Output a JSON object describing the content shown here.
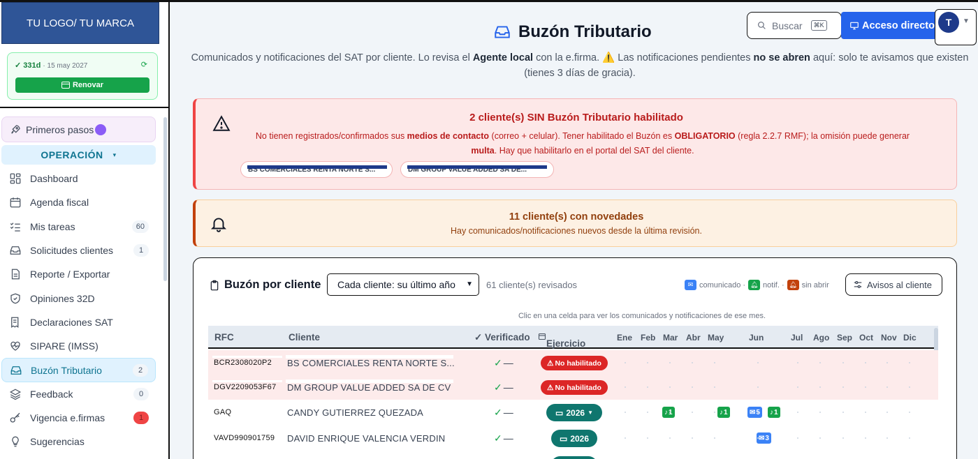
{
  "brand": {
    "logo_text": "TU LOGO/ TU MARCA"
  },
  "license": {
    "days": "✓ 331d",
    "date": "· 15 may 2027",
    "renew_label": "Renovar"
  },
  "sidebar": {
    "first_steps": "Primeros pasos",
    "section": "OPERACIÓN",
    "items": [
      {
        "label": "Dashboard",
        "icon": "dashboard-icon",
        "badge": ""
      },
      {
        "label": "Agenda fiscal",
        "icon": "calendar-icon",
        "badge": ""
      },
      {
        "label": "Mis tareas",
        "icon": "tasks-icon",
        "badge": "60"
      },
      {
        "label": "Solicitudes clientes",
        "icon": "inbox-icon",
        "badge": "1"
      },
      {
        "label": "Reporte / Exportar",
        "icon": "document-icon",
        "badge": ""
      },
      {
        "label": "Opiniones 32D",
        "icon": "shield-icon",
        "badge": ""
      },
      {
        "label": "Declaraciones SAT",
        "icon": "receipt-icon",
        "badge": ""
      },
      {
        "label": "SIPARE (IMSS)",
        "icon": "heart-pulse-icon",
        "badge": ""
      },
      {
        "label": "Buzón Tributario",
        "icon": "inbox-icon",
        "badge": "2"
      },
      {
        "label": "Feedback",
        "icon": "layers-icon",
        "badge": "0"
      },
      {
        "label": "Vigencia e.firmas",
        "icon": "key-icon",
        "badge": "1"
      },
      {
        "label": "Sugerencias",
        "icon": "lightbulb-icon",
        "badge": ""
      }
    ]
  },
  "header": {
    "title": "Buzón Tributario",
    "subtitle_1": "Comunicados y notificaciones del SAT por cliente. Lo revisa el ",
    "subtitle_b1": "Agente local",
    "subtitle_2": " con la e.firma. ⚠️ Las notificaciones pendientes ",
    "subtitle_b2": "no se abren",
    "subtitle_3": " aquí: solo te avisamos que existen (tienes 3 días de gracia).",
    "search_placeholder": "Buscar",
    "search_shortcut": "⌘K",
    "direct_label": "Acceso directo",
    "avatar_initial": "T"
  },
  "alert_red": {
    "title": "2 cliente(s) SIN Buzón Tributario habilitado",
    "t1": "No tienen registrados/confirmados sus ",
    "b1": "medios de contacto",
    "t2": " (correo + celular). Tener habilitado el Buzón es ",
    "b2": "OBLIGATORIO",
    "t3": " (regla 2.2.7 RMF); la omisión puede generar ",
    "b3": "multa",
    "t4": ". Hay que habilitarlo en el portal del SAT del cliente.",
    "chips": [
      "BS COMERCIALES RENTA NORTE S...",
      "DM GROUP VALUE ADDED SA DE..."
    ]
  },
  "alert_amber": {
    "title": "11 cliente(s) con novedades",
    "text": "Hay comunicados/notificaciones nuevos desde la última revisión."
  },
  "mailbox": {
    "title": "Buzón por cliente",
    "filter_value": "Cada cliente: su último año",
    "revised": "61 cliente(s) revisados",
    "legend_comunicado": "comunicado ·",
    "legend_notif": "notif. ·",
    "legend_sin_abrir": "sin abrir",
    "avisos_label": "Avisos al cliente",
    "hint": "Clic en una celda para ver los comunicados y notificaciones de ese mes.",
    "headers": {
      "rfc": "RFC",
      "cliente": "Cliente",
      "verificado": "✓ Verificado",
      "ejercicio": "Ejercicio",
      "months": [
        "Ene",
        "Feb",
        "Mar",
        "Abr",
        "May",
        "Jun",
        "Jul",
        "Ago",
        "Sep",
        "Oct",
        "Nov",
        "Dic"
      ]
    },
    "rows": [
      {
        "rfc": "BCR2308020P2",
        "cliente": "BS COMERCIALES RENTA NORTE S...",
        "verificado": "✓",
        "dash": "—",
        "ejercicio": "No habilitado"
      },
      {
        "rfc": "DGV2209053F67",
        "cliente": "DM GROUP VALUE ADDED SA DE CV",
        "verificado": "✓",
        "dash": "—",
        "ejercicio": "No habilitado"
      },
      {
        "rfc": "GAQ",
        "cliente": "CANDY GUTIERREZ QUEZADA",
        "verificado": "✓",
        "dash": "—",
        "ejercicio": "2026",
        "cells": {
          "mar": "1",
          "may": "1",
          "jun_c": "5",
          "jun_n": "1"
        }
      },
      {
        "rfc": "VAVD990901759",
        "cliente": "DAVID ENRIQUE VALENCIA VERDIN",
        "verificado": "✓",
        "dash": "—",
        "ejercicio": "2026",
        "cells": {
          "jun_c": "3"
        }
      }
    ]
  },
  "colors": {
    "accent": "#2563eb",
    "teal": "#0f766e",
    "danger": "#dc2626",
    "success": "#16a34a",
    "warning": "#c2410c"
  }
}
